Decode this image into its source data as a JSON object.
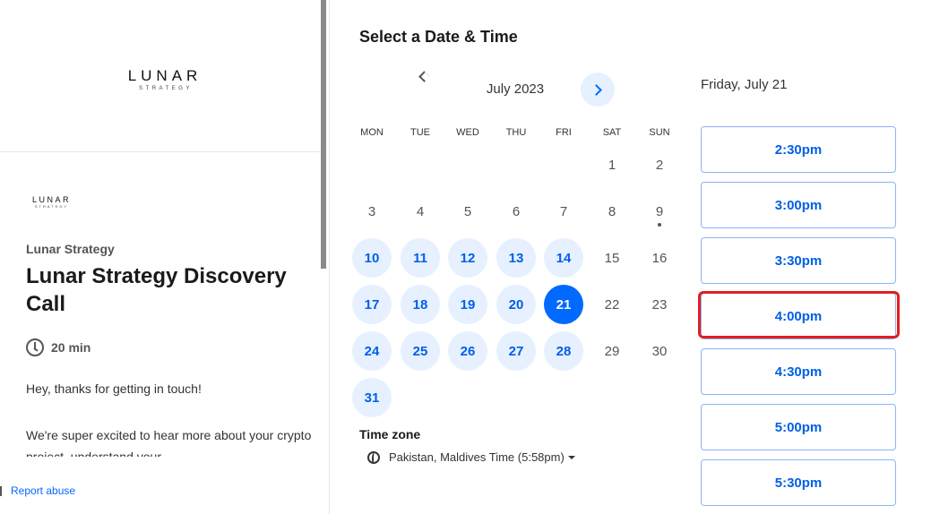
{
  "brand": {
    "name": "LUNAR",
    "sub": "STRATEGY"
  },
  "event": {
    "organizer": "Lunar Strategy",
    "title": "Lunar Strategy Discovery Call",
    "duration": "20 min",
    "description_1": "Hey, thanks for getting in touch!",
    "description_2": "We're super excited to hear more about your crypto project, understand your"
  },
  "footer": {
    "report_abuse": "Report abuse"
  },
  "scheduler": {
    "heading": "Select a Date & Time",
    "month": "July 2023",
    "weekdays": [
      "MON",
      "TUE",
      "WED",
      "THU",
      "FRI",
      "SAT",
      "SUN"
    ],
    "days": [
      "1",
      "2",
      "3",
      "4",
      "5",
      "6",
      "7",
      "8",
      "9",
      "10",
      "11",
      "12",
      "13",
      "14",
      "15",
      "16",
      "17",
      "18",
      "19",
      "20",
      "21",
      "22",
      "23",
      "24",
      "25",
      "26",
      "27",
      "28",
      "29",
      "30",
      "31"
    ],
    "available_days": [
      "10",
      "11",
      "12",
      "13",
      "14",
      "17",
      "18",
      "19",
      "20",
      "21",
      "24",
      "25",
      "26",
      "27",
      "28",
      "31"
    ],
    "selected_day": "21",
    "timezone_label": "Time zone",
    "timezone_value": "Pakistan, Maldives Time (5:58pm)",
    "selected_date_label": "Friday, July 21",
    "time_slots": [
      "2:30pm",
      "3:00pm",
      "3:30pm",
      "4:00pm",
      "4:30pm",
      "5:00pm",
      "5:30pm"
    ],
    "highlighted_slot": "4:00pm"
  },
  "icons": {
    "prev": "chevron-left-icon",
    "next": "chevron-right-icon",
    "clock": "clock-icon",
    "globe": "globe-icon",
    "caret": "caret-down-icon"
  },
  "colors": {
    "accent": "#0069ff",
    "accent_light": "#e6f0ff",
    "highlight": "#e02020"
  }
}
